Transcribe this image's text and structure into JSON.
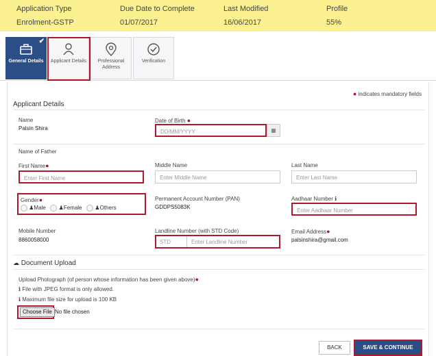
{
  "summary": {
    "headers": [
      "Application Type",
      "Due Date to Complete",
      "Last Modified",
      "Profile"
    ],
    "values": [
      "Enrolment-GSTP",
      "01/07/2017",
      "16/06/2017",
      "55%"
    ]
  },
  "steps": [
    {
      "label": "General Details",
      "icon": "briefcase-icon",
      "active": true
    },
    {
      "label": "Applicant Details",
      "icon": "user-icon",
      "active": false
    },
    {
      "label": "Professional Address",
      "icon": "location-pin-icon",
      "active": false
    },
    {
      "label": "Verification",
      "icon": "check-circle-icon",
      "active": false
    }
  ],
  "mandatory_note": "indicates mandatory fields",
  "applicant": {
    "section_title": "Applicant Details",
    "name_label": "Name",
    "name_value": "Palsin Shira",
    "dob_label": "Date of Birth",
    "dob_placeholder": "DD/MM/YYYY",
    "father_label": "Name of Father",
    "first_name_label": "First Name",
    "first_name_placeholder": "Enter First Name",
    "middle_name_label": "Middle Name",
    "middle_name_placeholder": "Enter Middle Name",
    "last_name_label": "Last Name",
    "last_name_placeholder": "Enter Last Name",
    "gender_label": "Gender",
    "gender_options": [
      "Male",
      "Female",
      "Others"
    ],
    "pan_label": "Permanent Account Number (PAN)",
    "pan_value": "GDDPS5083K",
    "aadhaar_label": "Aadhaar Number",
    "aadhaar_placeholder": "Enter Aadhaar Number",
    "mobile_label": "Mobile Number",
    "mobile_value": "8860058000",
    "landline_label": "Landline Number (with STD Code)",
    "std_placeholder": "STD",
    "landline_placeholder": "Enter Landline Number",
    "email_label": "Email Address",
    "email_value": "palsinshira@gmail.com"
  },
  "upload": {
    "section_title": "Document Upload",
    "photo_label": "Upload Photograph (of person whose information has been given above)",
    "note1": "File with JPEG format is only allowed.",
    "note2": "Maximum file size for upload is 100 KB",
    "choose_label": "Choose File",
    "no_file": "No file chosen"
  },
  "buttons": {
    "back": "BACK",
    "save": "SAVE & CONTINUE"
  },
  "colors": {
    "accent": "#2c4e86",
    "highlight": "#b1182a",
    "banner": "#fbf191"
  }
}
